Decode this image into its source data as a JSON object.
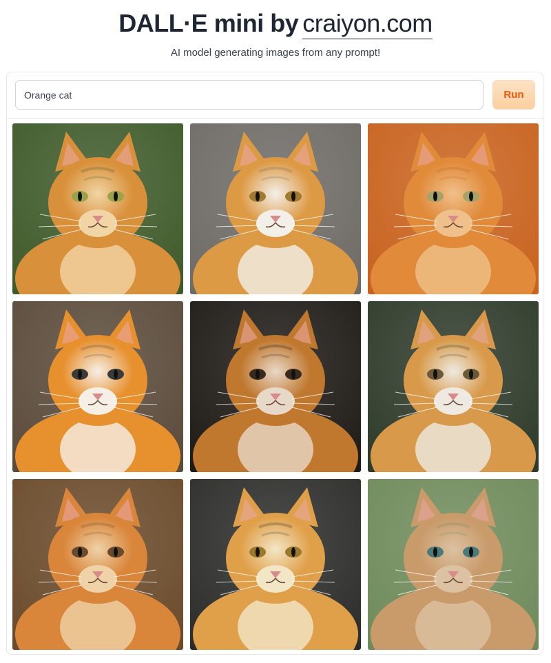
{
  "header": {
    "title_main": "DALL·E mini by",
    "title_link": "craiyon.com",
    "subtitle": "AI model generating images from any prompt!"
  },
  "prompt": {
    "value": "Orange cat",
    "run_label": "Run"
  },
  "gallery": {
    "images": [
      {
        "name": "orange-cat-image-1",
        "bg": "#3f5a2a",
        "fur": "#d9903a",
        "light": "#f1d5a5",
        "eye": "#9aa34a"
      },
      {
        "name": "orange-cat-image-2",
        "bg": "#6e6a66",
        "fur": "#dd9a45",
        "light": "#f3f0ea",
        "eye": "#a07a2e"
      },
      {
        "name": "orange-cat-image-3",
        "bg": "#c8621e",
        "fur": "#e08a3a",
        "light": "#f0c08a",
        "eye": "#a3a36a"
      },
      {
        "name": "orange-cat-image-4",
        "bg": "#5a4a3a",
        "fur": "#e7902e",
        "light": "#f6efe6",
        "eye": "#3a3a3a"
      },
      {
        "name": "orange-cat-image-5",
        "bg": "#1e1a16",
        "fur": "#c0782e",
        "light": "#e8d8c8",
        "eye": "#3a2a1e"
      },
      {
        "name": "orange-cat-image-6",
        "bg": "#2e3a2a",
        "fur": "#d89a4a",
        "light": "#eeeae2",
        "eye": "#6a5a3a"
      },
      {
        "name": "orange-cat-image-7",
        "bg": "#6a4a2a",
        "fur": "#d9853a",
        "light": "#efd2a8",
        "eye": "#6a4a2a"
      },
      {
        "name": "orange-cat-image-8",
        "bg": "#2c2c2a",
        "fur": "#e0a04a",
        "light": "#f3e6c6",
        "eye": "#9a7a2a"
      },
      {
        "name": "orange-cat-image-9",
        "bg": "#6e8a5a",
        "fur": "#c99a6a",
        "light": "#dcc2a2",
        "eye": "#4a7a7a"
      }
    ]
  }
}
